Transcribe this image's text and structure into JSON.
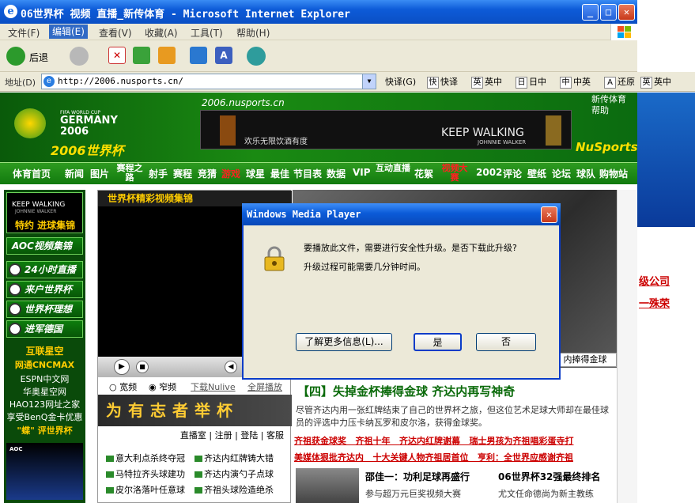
{
  "window": {
    "title": "06世界杯 视频 直播_新传体育 - Microsoft Internet Explorer"
  },
  "menu": [
    "文件(F)",
    "编辑(E)",
    "查看(V)",
    "收藏(A)",
    "工具(T)",
    "帮助(H)"
  ],
  "toolbar": {
    "back_label": "后退"
  },
  "address": {
    "label": "地址(D)",
    "url": "http://2006.nusports.cn/"
  },
  "quicktrans": {
    "label": "快译(G)",
    "items": [
      {
        "key": "快",
        "label": "快译"
      },
      {
        "key": "英",
        "label": "英中"
      },
      {
        "key": "日",
        "label": "日中"
      },
      {
        "key": "中",
        "label": "中英"
      },
      {
        "key": "A",
        "label": "还原"
      },
      {
        "key": "英",
        "label": "英中"
      }
    ]
  },
  "site": {
    "domain": "2006.nusports.cn",
    "logo_top": "FIFA WORLD CUP",
    "logo_country": "GERMANY",
    "logo_year": "2006",
    "logo_cn": "2006世界杯",
    "top_links": [
      "新传体育",
      "帮助"
    ],
    "brand": "NuSports",
    "banner_text": "欢乐无限饮酒有度",
    "banner_brand": "KEEP WALKING",
    "banner_sub": "JOHNNIE WALKER"
  },
  "nav": [
    "体育首页",
    "新闻",
    "图片",
    "赛程之路",
    "射手",
    "赛程",
    "竞猜",
    "游戏",
    "球星",
    "最佳",
    "节目表",
    "数据",
    "VIP",
    "互动直播",
    "花絮",
    "视频大赛",
    "2002",
    "评论",
    "壁纸",
    "论坛",
    "球队",
    "购物站"
  ],
  "left": {
    "kw_title": "KEEP WALKING",
    "kw_sub": "JOHNNIE WALKER",
    "kw_label": "特约 进球集锦",
    "aoc": "AOC视频集锦",
    "buttons": [
      "24小时直播",
      "来户世界杯",
      "世界杯理想",
      "进军德国"
    ],
    "texts": [
      "互联星空",
      "网通CNCMAX",
      "ESPN中文网",
      "华奥星空网",
      "HAO123网址之家",
      "享受BenQ金卡优惠",
      "\"蝶\" 评世界杯"
    ],
    "aoc_small": "AOC"
  },
  "video": {
    "heading": "世界杯精彩视频集锦",
    "opt1": "宽频",
    "opt2": "窄频",
    "opt3": "下载Nulive",
    "opt4": "全屏播放",
    "slogan": "为有志者举杯",
    "links": [
      "直播室",
      "注册",
      "登陆",
      "客服"
    ],
    "news_left": [
      "意大利点杀终夺冠",
      "马特拉齐头球建功",
      "皮尔洛落叶任意球"
    ],
    "news_right": [
      "齐达内红牌铸大错",
      "齐达内演勺子点球",
      "齐祖头球险造绝杀"
    ]
  },
  "main": {
    "caption": "内捧得金球",
    "headline": "【四】失掉金杯捧得金球 齐达内再写神奇",
    "lead": "尽管齐达内用一张红牌结束了自己的世界杯之旅，但这位艺术足球大师却在最佳球员的评选中力压卡纳瓦罗和皮尔洛，获得金球奖。",
    "red1": [
      "齐祖获金球奖",
      "齐祖十年",
      "齐达内红牌谢幕",
      "瑞士男孩为齐祖唱彩蛋寺打"
    ],
    "red2": [
      "美媒体狠批齐达内",
      "十大关键人物齐祖居首位",
      "亨利：全世界应感谢齐祖"
    ],
    "sub1_title": "邵佳一：功利足球再盛行",
    "sub1_text": "参与超万元巨奖视频大赛",
    "sub2_title": "06世界杯32强最终排名",
    "sub2_text": "尤文任命德尚为新主教练"
  },
  "right": {
    "line1": "级公司",
    "line2": "一殊荣"
  },
  "dialog": {
    "title": "Windows Media Player",
    "line1": "要播放此文件，需要进行安全性升级。是否下载此升级?",
    "line2": "升级过程可能需要几分钟时间。",
    "btn_more": "了解更多信息(L)...",
    "btn_yes": "是",
    "btn_no": "否"
  }
}
